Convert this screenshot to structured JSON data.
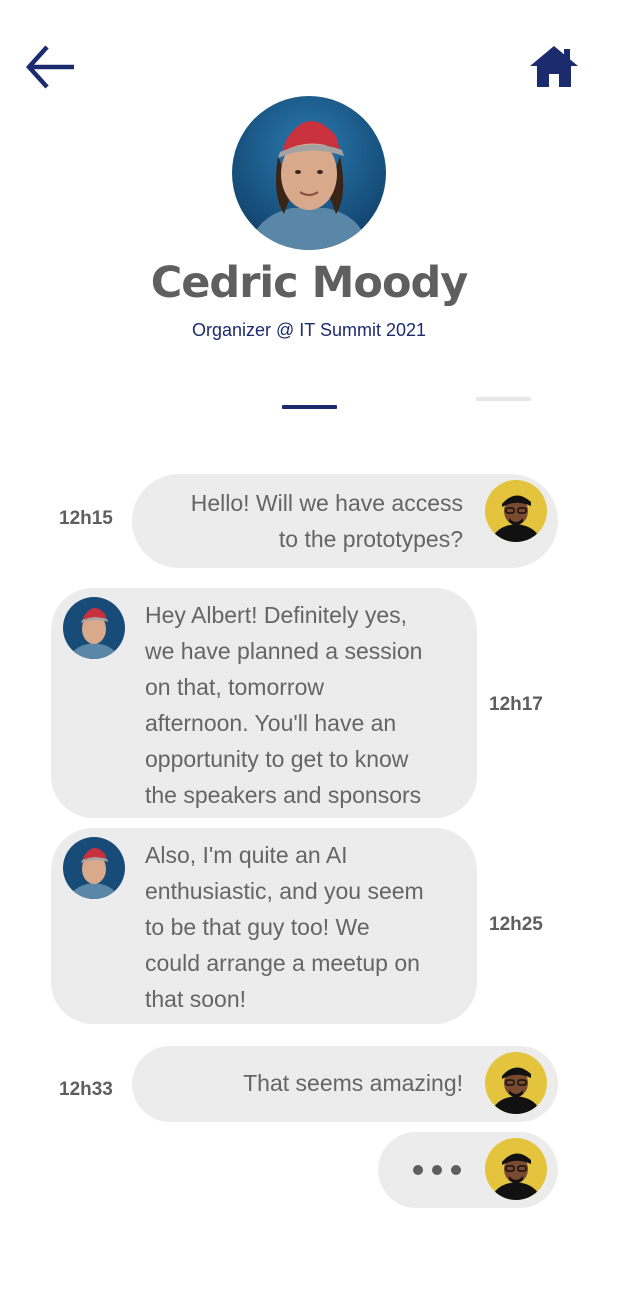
{
  "header": {
    "back_icon": "arrow-left-icon",
    "home_icon": "home-icon",
    "icon_color": "#1c2a6e"
  },
  "profile": {
    "name": "Cedric Moody",
    "role": "Organizer @ IT Summit 2021"
  },
  "colors": {
    "accent": "#1c2a6e",
    "bubble": "#ececec",
    "text": "#656565",
    "avatar_user_bg": "#e3c43c"
  },
  "messages": [
    {
      "sender": "user",
      "time": "12h15",
      "lines": [
        "Hello! Will we have access",
        "to the prototypes?"
      ]
    },
    {
      "sender": "organizer",
      "time": "12h17",
      "lines": [
        "Hey Albert! Definitely yes,",
        "we have planned a session",
        "on that, tomorrow",
        "afternoon. You'll have an",
        "opportunity to get to know",
        "the speakers and sponsors"
      ]
    },
    {
      "sender": "organizer",
      "time": "12h25",
      "lines": [
        "Also, I'm quite an AI",
        "enthusiastic, and you seem",
        "to be that guy too! We",
        "could arrange a meetup on",
        "that soon!"
      ]
    },
    {
      "sender": "user",
      "time": "12h33",
      "lines": [
        "That seems amazing!"
      ]
    }
  ],
  "typing_indicator": {
    "sender": "user",
    "icon": "typing-dots-icon"
  }
}
